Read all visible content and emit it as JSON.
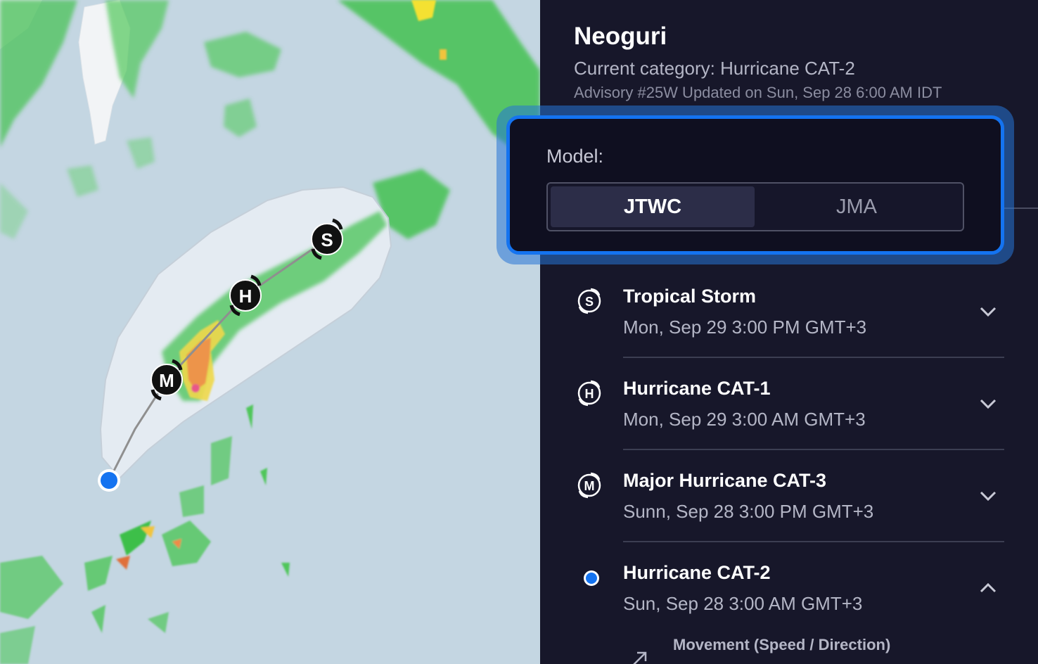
{
  "storm": {
    "name": "Neoguri",
    "category": "Current category: Hurricane CAT-2",
    "advisory": "Advisory #25W Updated on Sun, Sep 28 6:00 AM IDT"
  },
  "model": {
    "label": "Model:",
    "options": [
      "JTWC",
      "JMA"
    ],
    "selected": "JTWC"
  },
  "track": {
    "markers": [
      {
        "letter": "S",
        "label": "Tropical Storm"
      },
      {
        "letter": "H",
        "label": "Hurricane CAT-1"
      },
      {
        "letter": "M",
        "label": "Major Hurricane CAT-3"
      }
    ]
  },
  "forecast": [
    {
      "icon": "tropical-storm-icon",
      "letter": "S",
      "title": "Tropical Storm",
      "time": "Mon, Sep 29 3:00 PM GMT+3",
      "expanded": false
    },
    {
      "icon": "hurricane-icon",
      "letter": "H",
      "title": "Hurricane CAT-1",
      "time": "Mon, Sep 29 3:00 AM GMT+3",
      "expanded": false
    },
    {
      "icon": "major-hurricane-icon",
      "letter": "M",
      "title": "Major Hurricane CAT-3",
      "time": "Sunn, Sep 28 3:00 PM GMT+3",
      "expanded": false
    },
    {
      "icon": "current-position-icon",
      "letter": "",
      "title": "Hurricane CAT-2",
      "time": "Sun, Sep 28 3:00 AM GMT+3",
      "expanded": true
    }
  ],
  "details": {
    "movement_label": "Movement (Speed / Direction)"
  },
  "colors": {
    "accent": "#1473f0",
    "panel_bg": "#17172a",
    "map_water": "#c4d6e2",
    "cone_fill": "#e4ecf2",
    "radar_green": "#3ec24a"
  }
}
